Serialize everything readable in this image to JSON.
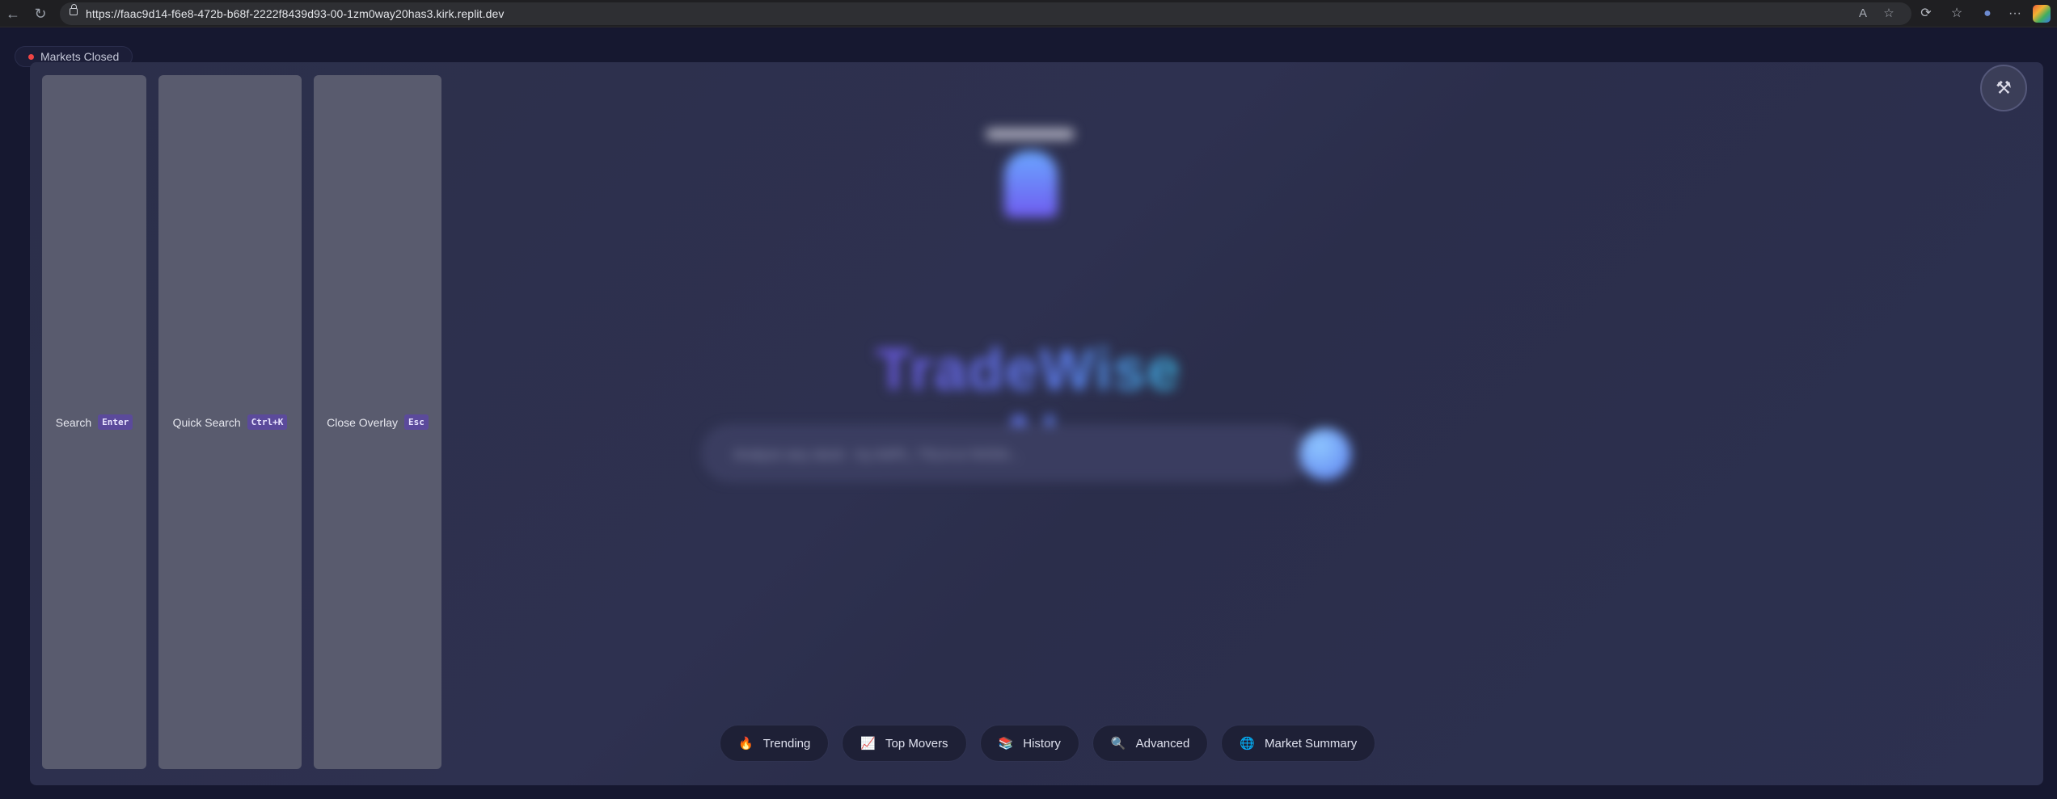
{
  "browser": {
    "url": "https://faac9d14-f6e8-472b-b68f-2222f8439d93-00-1zm0way20has3.kirk.replit.dev",
    "back_icon": "←",
    "refresh_icon": "↻",
    "read_aloud_icon": "A",
    "favorite_icon": "☆",
    "extensions_icon": "⟳",
    "favorites_bar_icon": "☆",
    "profile_icon": "●",
    "more_icon": "···"
  },
  "market_status": {
    "label": "Markets Closed",
    "color": "#ef4444"
  },
  "overlay": {
    "shortcuts": [
      {
        "label": "Search",
        "key": "Enter"
      },
      {
        "label": "Quick Search",
        "key": "Ctrl+K"
      },
      {
        "label": "Close Overlay",
        "key": "Esc"
      }
    ],
    "tools_icon": "⚒"
  },
  "app": {
    "brand": "TradeWise AI",
    "search_placeholder": "Analyze any stock - try AAPL, TSLA or NVDA...",
    "quick_chips": [
      {
        "icon": "🔥",
        "label": "Trending"
      },
      {
        "icon": "📈",
        "label": "Top Movers"
      },
      {
        "icon": "📚",
        "label": "History"
      },
      {
        "icon": "🔍",
        "label": "Advanced"
      },
      {
        "icon": "🌐",
        "label": "Market Summary"
      }
    ]
  },
  "colors": {
    "accent": "#5b4a9b",
    "background": "#161830",
    "overlay": "#2d3050"
  }
}
